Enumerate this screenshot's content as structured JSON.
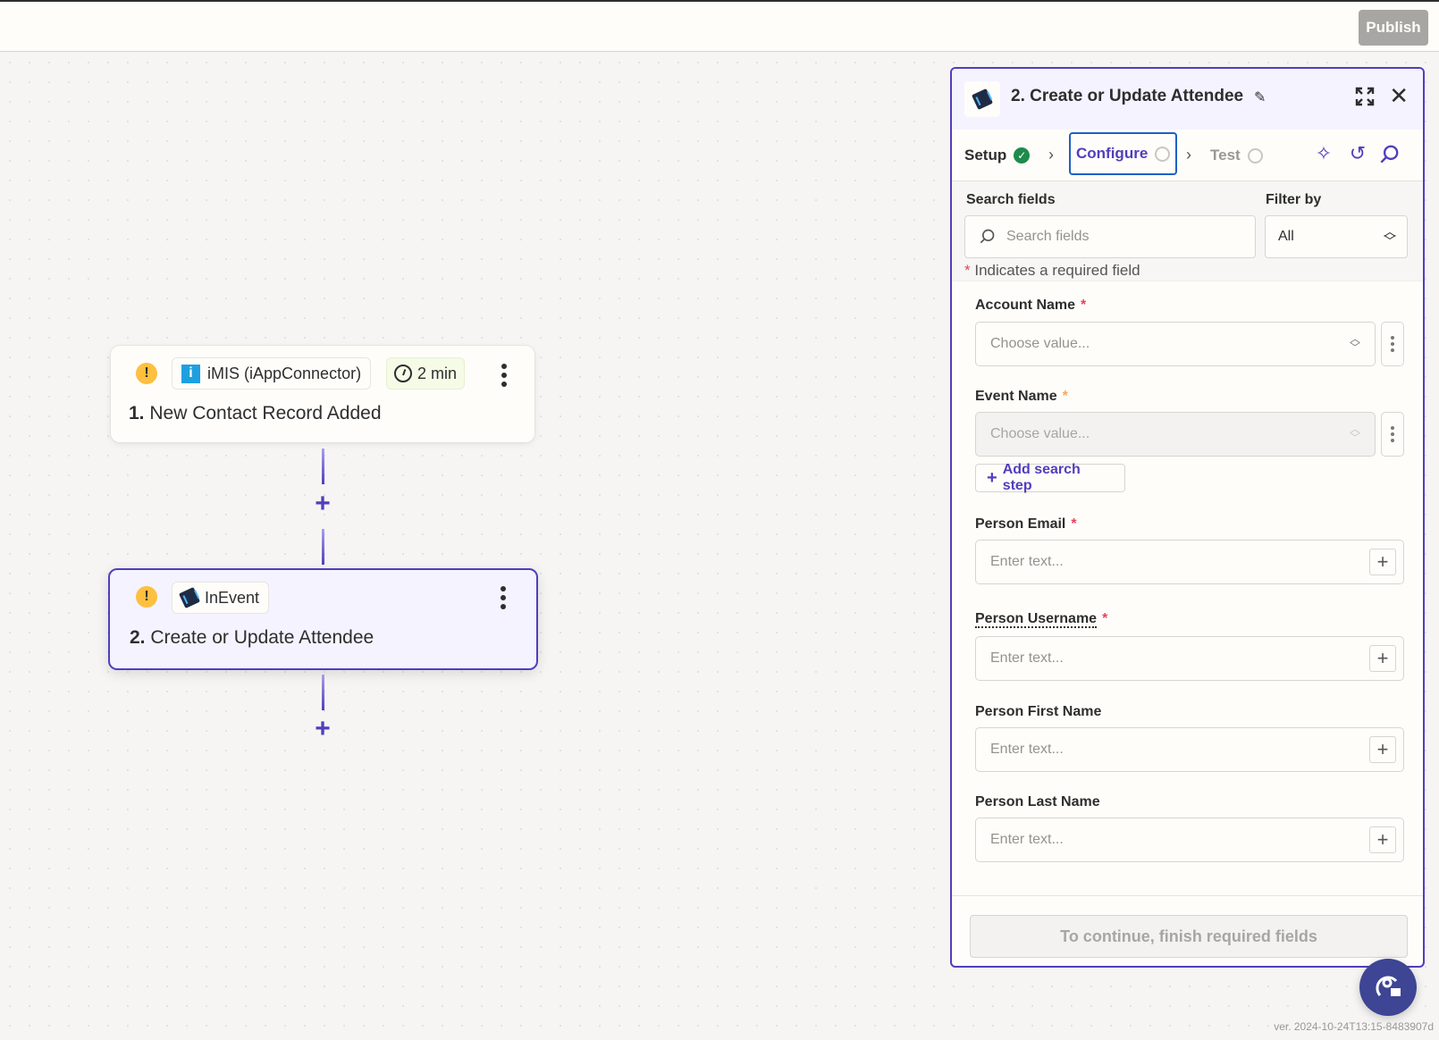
{
  "topbar": {
    "publish_label": "Publish"
  },
  "canvas": {
    "nodes": [
      {
        "app": "iMIS (iAppConnector)",
        "time": "2 min",
        "step_number": "1.",
        "title": "New Contact Record Added"
      },
      {
        "app": "InEvent",
        "step_number": "2.",
        "title": "Create or Update Attendee"
      }
    ]
  },
  "panel": {
    "title": "2. Create or Update Attendee",
    "tabs": [
      {
        "label": "Setup",
        "status": "complete"
      },
      {
        "label": "Configure",
        "status": "active"
      },
      {
        "label": "Test",
        "status": "pending"
      }
    ],
    "search": {
      "label": "Search fields",
      "placeholder": "Search fields",
      "filter_label": "Filter by",
      "filter_value": "All",
      "required_note_mark": "*",
      "required_note": "Indicates a required field"
    },
    "fields": [
      {
        "label": "Account Name",
        "required": "*",
        "type": "select",
        "placeholder": "Choose value..."
      },
      {
        "label": "Event Name",
        "required": "*",
        "type": "select",
        "placeholder": "Choose value...",
        "disabled": true
      },
      {
        "label": "Person Email",
        "required": "*",
        "type": "text",
        "placeholder": "Enter text..."
      },
      {
        "label": "Person Username",
        "required": "*",
        "type": "text",
        "placeholder": "Enter text..."
      },
      {
        "label": "Person First Name",
        "type": "text",
        "placeholder": "Enter text..."
      },
      {
        "label": "Person Last Name",
        "type": "text",
        "placeholder": "Enter text..."
      }
    ],
    "add_search_step_label": "Add search step",
    "continue_label": "To continue, finish required fields"
  },
  "footer": {
    "version": "ver. 2024-10-24T13:15-8483907d"
  },
  "colors": {
    "accent": "#503ebd",
    "required": "#e8425c",
    "success": "#1f8a4c",
    "warning": "#ffbf3f"
  }
}
